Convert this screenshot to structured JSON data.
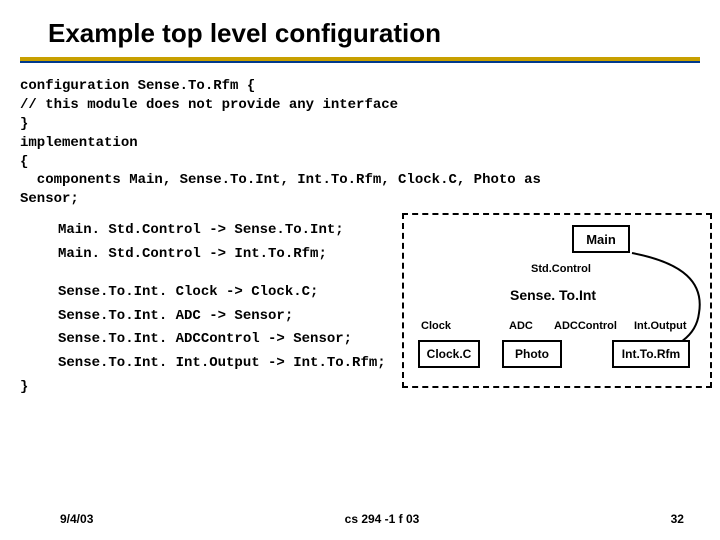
{
  "title": "Example top level configuration",
  "code": {
    "line1": "configuration Sense.To.Rfm {",
    "line2": "// this module does not provide any interface",
    "line3": "}",
    "line4": "implementation",
    "line5": "{",
    "line6": "  components Main, Sense.To.Int, Int.To.Rfm, Clock.C, Photo as",
    "line6b": "Sensor;",
    "line7": "Main. Std.Control -> Sense.To.Int;",
    "line8": "Main. Std.Control -> Int.To.Rfm;",
    "line9": "Sense.To.Int. Clock -> Clock.C;",
    "line10": "Sense.To.Int. ADC -> Sensor;",
    "line11": "Sense.To.Int. ADCControl -> Sensor;",
    "line12": "Sense.To.Int. Int.Output -> Int.To.Rfm;",
    "line13": "}"
  },
  "diagram": {
    "main": "Main",
    "stdcontrol": "Std.Control",
    "sensetoint": "Sense. To.Int",
    "clock": "Clock",
    "adc": "ADC",
    "adccontrol": "ADCControl",
    "intoutput": "Int.Output",
    "clockc": "Clock.C",
    "photo": "Photo",
    "inttorfm": "Int.To.Rfm"
  },
  "footer": {
    "date": "9/4/03",
    "center": "cs 294 -1 f 03",
    "page": "32"
  }
}
